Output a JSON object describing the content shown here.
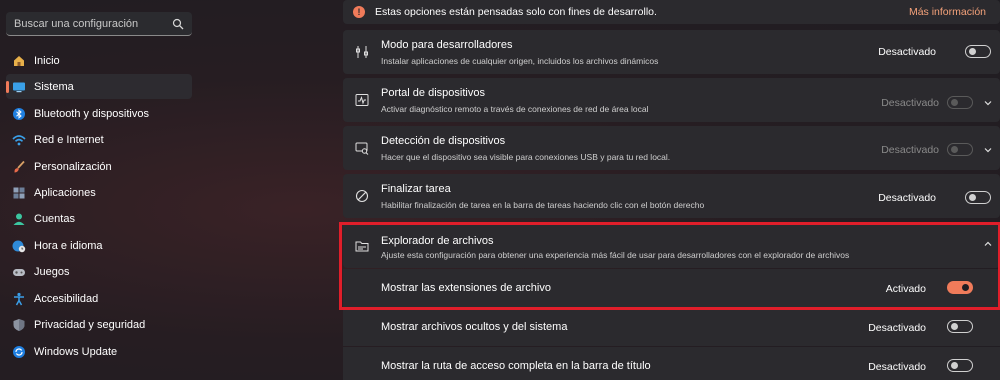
{
  "search": {
    "placeholder": "Buscar una configuración",
    "icon": "search-icon"
  },
  "sidebar": {
    "accent_color": "#f07b5a",
    "items": [
      {
        "label": "Inicio",
        "icon": "home-icon"
      },
      {
        "label": "Sistema",
        "icon": "display-icon",
        "active": true
      },
      {
        "label": "Bluetooth y dispositivos",
        "icon": "bluetooth-icon"
      },
      {
        "label": "Red e Internet",
        "icon": "wifi-icon"
      },
      {
        "label": "Personalización",
        "icon": "brush-icon"
      },
      {
        "label": "Aplicaciones",
        "icon": "apps-icon"
      },
      {
        "label": "Cuentas",
        "icon": "person-icon"
      },
      {
        "label": "Hora e idioma",
        "icon": "globe-clock-icon"
      },
      {
        "label": "Juegos",
        "icon": "gamepad-icon"
      },
      {
        "label": "Accesibilidad",
        "icon": "accessibility-icon"
      },
      {
        "label": "Privacidad y seguridad",
        "icon": "shield-icon"
      },
      {
        "label": "Windows Update",
        "icon": "update-icon"
      }
    ]
  },
  "banner": {
    "text": "Estas opciones están pensadas solo con fines de desarrollo.",
    "link": "Más información",
    "icon": "info-icon"
  },
  "settings": [
    {
      "title": "Modo para desarrolladores",
      "subtitle": "Instalar aplicaciones de cualquier origen, incluidos los archivos dinámicos",
      "state": "Desactivado",
      "enabled": true,
      "on": false,
      "icon": "developer-tools-icon"
    },
    {
      "title": "Portal de dispositivos",
      "subtitle": "Activar diagnóstico remoto a través de conexiones de red de área local",
      "state": "Desactivado",
      "enabled": false,
      "on": false,
      "icon": "diagnostics-icon"
    },
    {
      "title": "Detección de dispositivos",
      "subtitle": "Hacer que el dispositivo sea visible para conexiones USB y para tu red local.",
      "state": "Desactivado",
      "enabled": false,
      "on": false,
      "icon": "device-discovery-icon"
    },
    {
      "title": "Finalizar tarea",
      "subtitle": "Habilitar finalización de tarea en la barra de tareas haciendo clic con el botón derecho",
      "state": "Desactivado",
      "enabled": true,
      "on": false,
      "icon": "end-task-icon"
    },
    {
      "title": "Explorador de archivos",
      "subtitle": "Ajuste esta configuración para obtener una experiencia más fácil de usar para desarrolladores con el explorador de archivos",
      "icon": "file-explorer-icon"
    }
  ],
  "explorer_options": [
    {
      "title": "Mostrar las extensiones de archivo",
      "state": "Activado",
      "on": true
    },
    {
      "title": "Mostrar archivos ocultos y del sistema",
      "state": "Desactivado",
      "on": false
    },
    {
      "title": "Mostrar la ruta de acceso completa en la barra de título",
      "state": "Desactivado",
      "on": false
    }
  ],
  "highlight_color": "#e01e2a"
}
